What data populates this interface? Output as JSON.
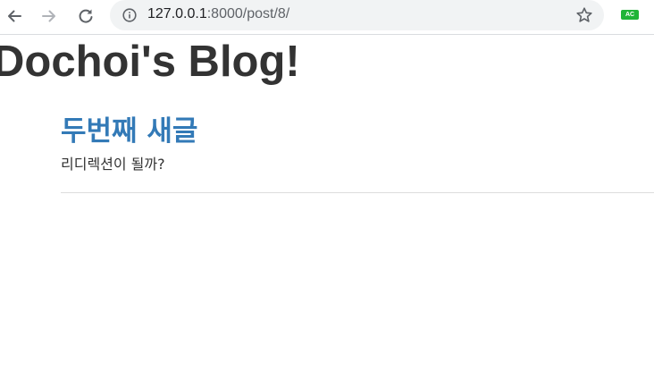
{
  "browser": {
    "url_host": "127.0.0.1",
    "url_path": ":8000/post/8/",
    "extension_badge": "AC",
    "icons": {
      "back": "arrow-left-icon",
      "forward": "arrow-right-icon",
      "reload": "reload-icon",
      "site_info": "info-icon",
      "bookmark": "star-icon"
    }
  },
  "page": {
    "header_title": "Dochoi's Blog!"
  },
  "post": {
    "title": "두번째 새글",
    "body": "리디렉션이 될까?"
  },
  "colors": {
    "link": "#337ab7",
    "text": "#333333",
    "divider": "#dddddd",
    "omnibox_bg": "#f1f3f4",
    "extension_badge_bg": "#1fb437"
  }
}
